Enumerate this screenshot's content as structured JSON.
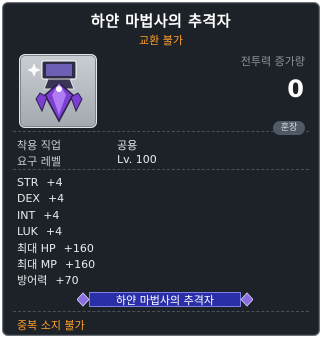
{
  "item": {
    "name": "하얀 마법사의 추격자",
    "trade_status": "교환 불가",
    "combat_power_label": "전투력 증가량",
    "combat_power_value": "0",
    "badge": "훈장",
    "icon": "white-mage-chaser-medal-icon"
  },
  "requirements": [
    {
      "label": "착용 직업",
      "value": "공용"
    },
    {
      "label": "요구 레벨",
      "value": "Lv. 100"
    }
  ],
  "stats": [
    {
      "label": "STR",
      "value": "+4"
    },
    {
      "label": "DEX",
      "value": "+4"
    },
    {
      "label": "INT",
      "value": "+4"
    },
    {
      "label": "LUK",
      "value": "+4"
    },
    {
      "label": "최대 HP",
      "value": "+160"
    },
    {
      "label": "최대 MP",
      "value": "+160"
    },
    {
      "label": "방어력",
      "value": "+70"
    }
  ],
  "set_name": "하얀 마법사의 추격자",
  "footer": "중복 소지 불가",
  "colors": {
    "background": "#1c2228",
    "accent_orange": "#ff9e2c",
    "set_banner": "#2a2fa8"
  }
}
